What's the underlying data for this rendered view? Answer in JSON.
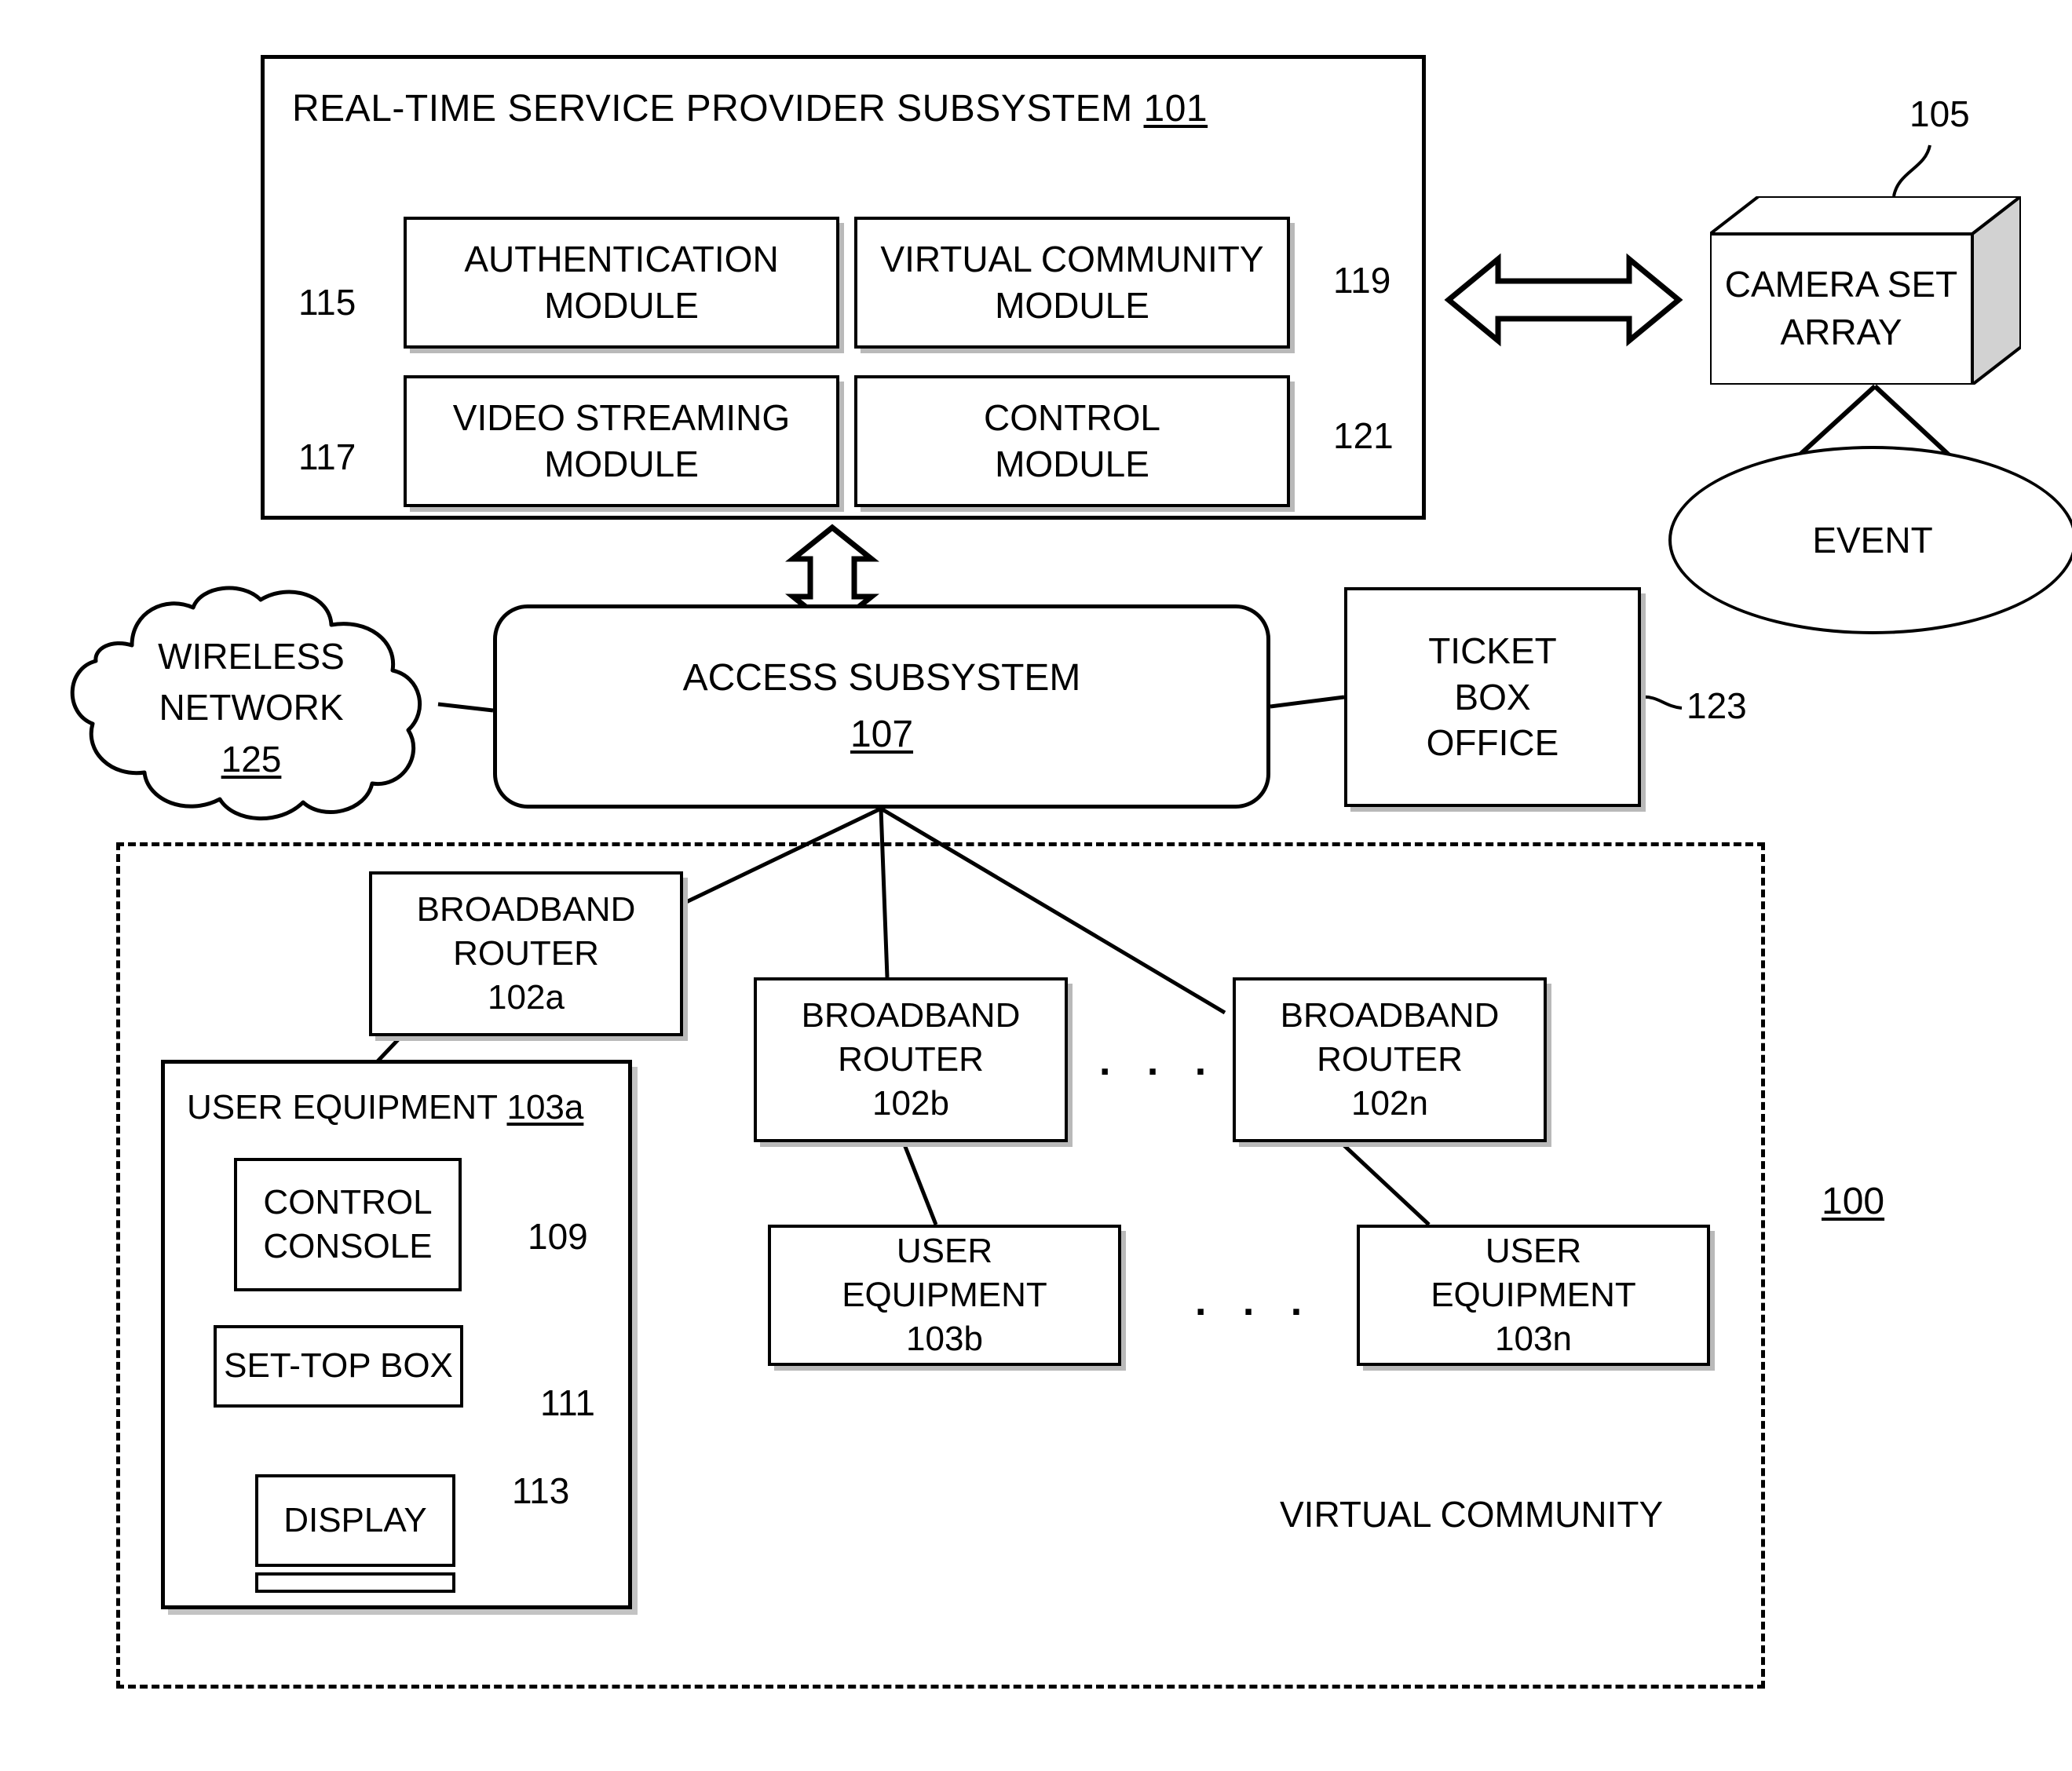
{
  "figure": {
    "id_label": "100",
    "virtual_community_label": "VIRTUAL COMMUNITY"
  },
  "subsystem": {
    "title": "REAL-TIME SERVICE PROVIDER SUBSYSTEM",
    "ref": "101",
    "modules": [
      {
        "line1": "AUTHENTICATION",
        "line2": "MODULE",
        "ref": "115"
      },
      {
        "line1": "VIRTUAL COMMUNITY",
        "line2": "MODULE",
        "ref": "119"
      },
      {
        "line1": "VIDEO STREAMING",
        "line2": "MODULE",
        "ref": "117"
      },
      {
        "line1": "CONTROL",
        "line2": "MODULE",
        "ref": "121"
      }
    ]
  },
  "camera": {
    "line1": "CAMERA SET",
    "line2": "ARRAY",
    "ref": "105"
  },
  "event": {
    "label": "EVENT"
  },
  "wireless": {
    "line1": "WIRELESS",
    "line2": "NETWORK",
    "ref": "125"
  },
  "access": {
    "title": "ACCESS SUBSYSTEM",
    "ref": "107"
  },
  "ticket": {
    "line1": "TICKET",
    "line2": "BOX",
    "line3": "OFFICE",
    "ref": "123"
  },
  "routers": [
    {
      "line1": "BROADBAND",
      "line2": "ROUTER",
      "ref": "102a"
    },
    {
      "line1": "BROADBAND",
      "line2": "ROUTER",
      "ref": "102b"
    },
    {
      "line1": "BROADBAND",
      "line2": "ROUTER",
      "ref": "102n"
    }
  ],
  "router_ellipsis": ". . .",
  "user_equipment_a": {
    "title": "USER EQUIPMENT",
    "ref": "103a",
    "children": [
      {
        "line1": "CONTROL",
        "line2": "CONSOLE",
        "ref": "109"
      },
      {
        "line1": "SET-TOP BOX",
        "line2": "",
        "ref": "111"
      },
      {
        "line1": "DISPLAY",
        "line2": "",
        "ref": "113"
      }
    ]
  },
  "user_equipment_others": [
    {
      "line1": "USER",
      "line2": "EQUIPMENT",
      "ref": "103b"
    },
    {
      "line1": "USER",
      "line2": "EQUIPMENT",
      "ref": "103n"
    }
  ],
  "ue_ellipsis": ". . .",
  "colors": {
    "stroke": "#000000",
    "background": "#ffffff",
    "shadow": "#bbbbbb",
    "camera_face_shade": "#cfcfcf"
  }
}
